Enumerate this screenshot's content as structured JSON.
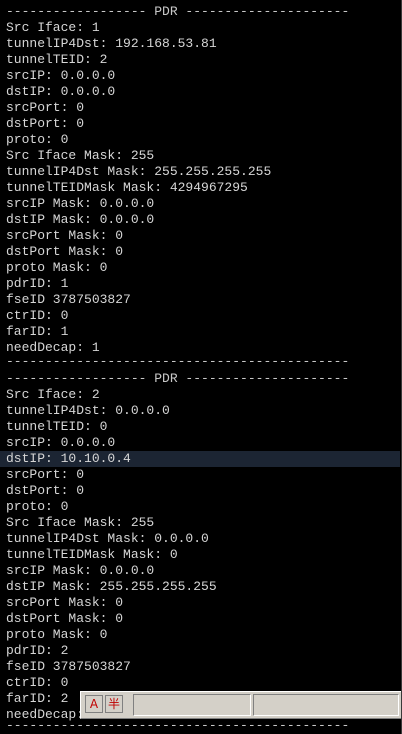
{
  "terminal": {
    "lines": [
      "------------------ PDR ---------------------",
      "Src Iface: 1",
      "tunnelIP4Dst: 192.168.53.81",
      "tunnelTEID: 2",
      "srcIP: 0.0.0.0",
      "dstIP: 0.0.0.0",
      "srcPort: 0",
      "dstPort: 0",
      "proto: 0",
      "Src Iface Mask: 255",
      "tunnelIP4Dst Mask: 255.255.255.255",
      "tunnelTEIDMask Mask: 4294967295",
      "srcIP Mask: 0.0.0.0",
      "dstIP Mask: 0.0.0.0",
      "srcPort Mask: 0",
      "dstPort Mask: 0",
      "proto Mask: 0",
      "pdrID: 1",
      "fseID 3787503827",
      "ctrID: 0",
      "farID: 1",
      "needDecap: 1",
      "--------------------------------------------",
      "------------------ PDR ---------------------",
      "Src Iface: 2",
      "tunnelIP4Dst: 0.0.0.0",
      "tunnelTEID: 0",
      "srcIP: 0.0.0.0",
      "dstIP: 10.10.0.4",
      "srcPort: 0",
      "dstPort: 0",
      "proto: 0",
      "Src Iface Mask: 255",
      "tunnelIP4Dst Mask: 0.0.0.0",
      "tunnelTEIDMask Mask: 0",
      "srcIP Mask: 0.0.0.0",
      "dstIP Mask: 255.255.255.255",
      "srcPort Mask: 0",
      "dstPort Mask: 0",
      "proto Mask: 0",
      "pdrID: 2",
      "fseID 3787503827",
      "ctrID: 0",
      "farID: 2",
      "needDecap: 1",
      "--------------------------------------------"
    ],
    "highlighted_line": "dstIP: 10.10.0.4",
    "colors": {
      "background": "#000000",
      "text": "#d6d6d6",
      "highlight": "#1c2533"
    }
  },
  "ime_toolbar": {
    "mode_label": "A",
    "width_label": "半",
    "icon_mode": "ime-mode-icon",
    "icon_width": "half-width-icon"
  }
}
